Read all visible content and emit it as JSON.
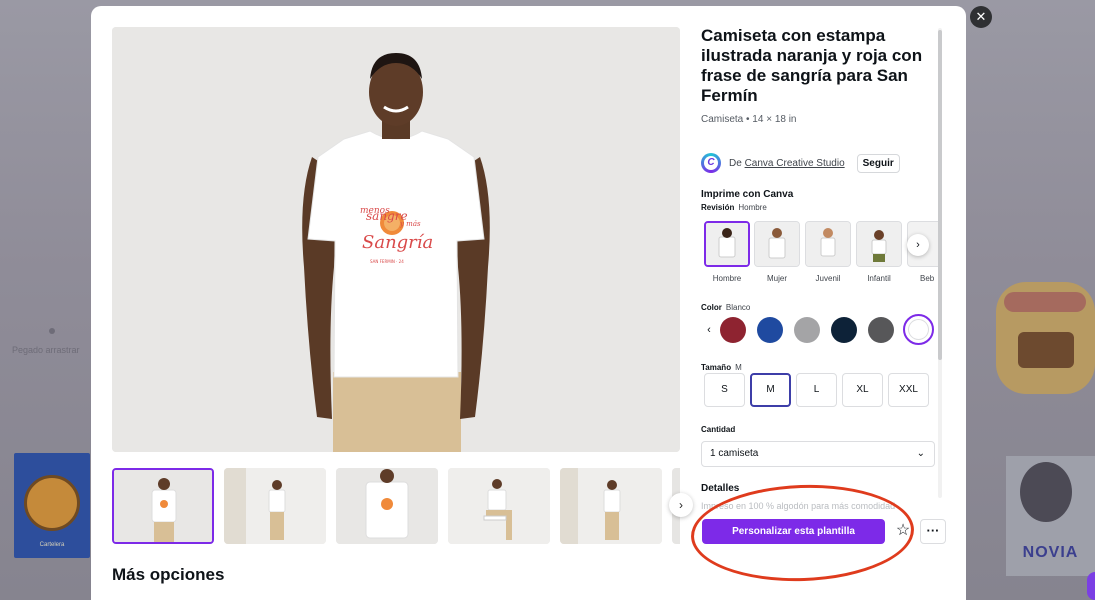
{
  "product": {
    "title": "Camiseta con estampa ilustrada naranja y roja con frase de sangría para San Fermín",
    "subtitle": "Camiseta • 14 × 18 in",
    "author_prefix": "De",
    "author_name": "Canva Creative Studio",
    "follow_label": "Seguir",
    "print_title": "Imprime con Canva",
    "revision_label": "Revisión",
    "revision_value": "Hombre",
    "revision_options": [
      "Hombre",
      "Mujer",
      "Juvenil",
      "Infantil",
      "Beb"
    ],
    "color_label": "Color",
    "color_value": "Blanco",
    "colors": [
      "#8e2330",
      "#1f4aa0",
      "#a4a4a6",
      "#0d2238",
      "#575759",
      "#ffffff"
    ],
    "size_label": "Tamaño",
    "size_value": "M",
    "sizes": [
      "S",
      "M",
      "L",
      "XL",
      "XXL"
    ],
    "quantity_label": "Cantidad",
    "quantity_value": "1 camiseta",
    "details_title": "Detalles",
    "details_text": "Impreso en 100 % algodón para más comodidad"
  },
  "design": {
    "line1": "menos",
    "line2": "sangre",
    "line3": "y más",
    "line4": "Sangría",
    "footer": "SAN FERMIN · 24"
  },
  "actions": {
    "customize_label": "Personalizar esta plantilla",
    "more_options_heading": "Más opciones"
  },
  "background": {
    "card_caption": "Cartelera",
    "left_label": "Pegado arrastrar",
    "right_text": "NOVIA"
  },
  "icons": {
    "close": "✕",
    "next": "›",
    "prev": "‹",
    "chevron_down": "⌄",
    "star": "☆",
    "more": "···"
  },
  "colors": {
    "accent": "#7d2ae8",
    "annotation": "#df3b1d"
  }
}
